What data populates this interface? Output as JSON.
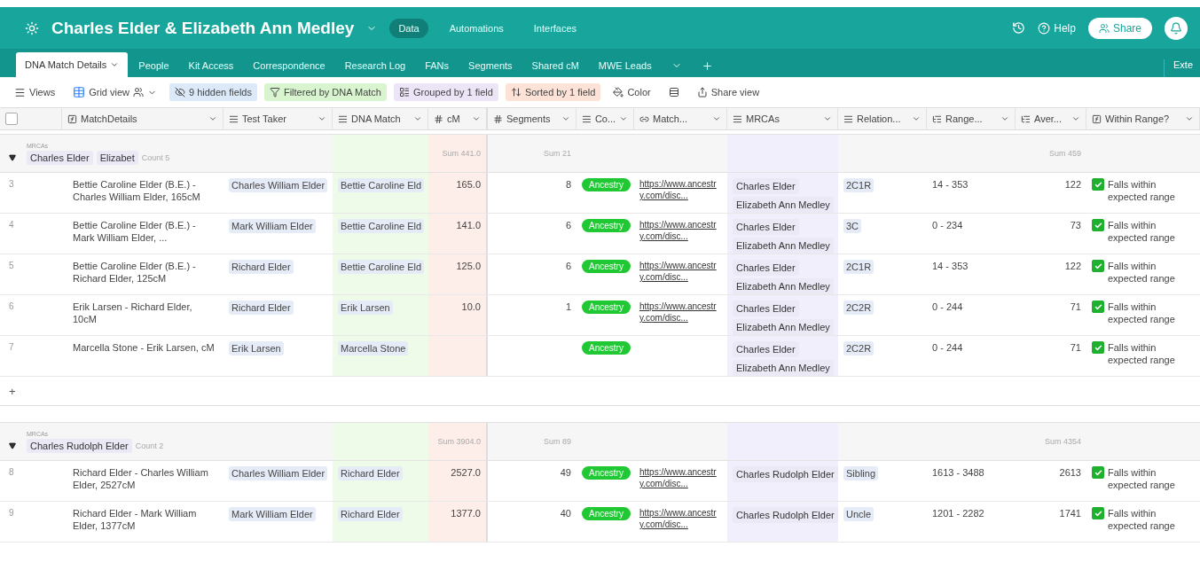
{
  "top_bar": {
    "title": "Charles Elder & Elizabeth Ann Medley",
    "nav": [
      {
        "label": "Data",
        "selected": true
      },
      {
        "label": "Automations",
        "selected": false
      },
      {
        "label": "Interfaces",
        "selected": false
      }
    ],
    "help": "Help",
    "share": "Share"
  },
  "table_tabs": [
    {
      "label": "DNA Match Details",
      "selected": true
    },
    {
      "label": "People",
      "selected": false
    },
    {
      "label": "Kit Access",
      "selected": false
    },
    {
      "label": "Correspondence",
      "selected": false
    },
    {
      "label": "Research Log",
      "selected": false
    },
    {
      "label": "FANs",
      "selected": false
    },
    {
      "label": "Segments",
      "selected": false
    },
    {
      "label": "Shared cM",
      "selected": false
    },
    {
      "label": "MWE Leads",
      "selected": false
    }
  ],
  "extensions_label": "Exte",
  "toolbar": {
    "views": "Views",
    "view_name": "Grid view",
    "buttons": [
      {
        "kind": "hide",
        "label": "9 hidden fields"
      },
      {
        "kind": "filter",
        "label": "Filtered by DNA Match"
      },
      {
        "kind": "group",
        "label": "Grouped by 1 field"
      },
      {
        "kind": "sort",
        "label": "Sorted by 1 field"
      },
      {
        "kind": "color",
        "label": "Color"
      },
      {
        "kind": "height"
      },
      {
        "kind": "share",
        "label": "Share view"
      }
    ]
  },
  "select_all": {
    "checked": false
  },
  "columns": [
    {
      "label": "MatchDetails",
      "kind": "formula"
    },
    {
      "label": "Test Taker",
      "kind": "link"
    },
    {
      "label": "DNA Match",
      "kind": "link",
      "color": "#eefbe9"
    },
    {
      "label": "cM",
      "kind": "number",
      "color": "#fdeeea"
    },
    {
      "label": "Segments",
      "kind": "number"
    },
    {
      "label": "Co...",
      "kind": "select"
    },
    {
      "label": "Match...",
      "kind": "url"
    },
    {
      "label": "MRCAs",
      "kind": "link",
      "color": "#f1effb"
    },
    {
      "label": "Relation...",
      "kind": "link"
    },
    {
      "label": "Range...",
      "kind": "lookup"
    },
    {
      "label": "Aver...",
      "kind": "lookup"
    },
    {
      "label": "Within Range?",
      "kind": "formula"
    }
  ],
  "groups": [
    {
      "field_label": "MRCAs",
      "values": [
        "Charles Elder",
        "Elizabet"
      ],
      "count": "Count 5",
      "sums": {
        "cm": "Sum 441.0",
        "segments": "Sum 21",
        "average": "Sum 459"
      },
      "rows": [
        {
          "number": "3",
          "match_details": "Bettie Caroline Elder (B.E.) - Charles William Elder, 165cM",
          "test_taker": "Charles William Elder",
          "dna_match": "Bettie Caroline Eld",
          "cm": "165.0",
          "segments": "8",
          "company": "Ancestry",
          "match_url": "https://www.ancestry.com/disc...",
          "mrcas": [
            "Charles Elder",
            "Elizabeth Ann Medley"
          ],
          "relationship": "2C1R",
          "range": "14 - 353",
          "average": "122",
          "within_range": {
            "checked": true,
            "text": "Falls within expected range"
          }
        },
        {
          "number": "4",
          "match_details": "Bettie Caroline Elder (B.E.) - Mark William Elder, ...",
          "test_taker": "Mark William Elder",
          "dna_match": "Bettie Caroline Eld",
          "cm": "141.0",
          "segments": "6",
          "company": "Ancestry",
          "match_url": "https://www.ancestry.com/disc...",
          "mrcas": [
            "Charles Elder",
            "Elizabeth Ann Medley"
          ],
          "relationship": "3C",
          "range": "0 - 234",
          "average": "73",
          "within_range": {
            "checked": true,
            "text": "Falls within expected range"
          }
        },
        {
          "number": "5",
          "match_details": "Bettie Caroline Elder (B.E.) - Richard Elder, 125cM",
          "test_taker": "Richard Elder",
          "dna_match": "Bettie Caroline Eld",
          "cm": "125.0",
          "segments": "6",
          "company": "Ancestry",
          "match_url": "https://www.ancestry.com/disc...",
          "mrcas": [
            "Charles Elder",
            "Elizabeth Ann Medley"
          ],
          "relationship": "2C1R",
          "range": "14 - 353",
          "average": "122",
          "within_range": {
            "checked": true,
            "text": "Falls within expected range"
          }
        },
        {
          "number": "6",
          "match_details": "Erik Larsen - Richard Elder, 10cM",
          "test_taker": "Richard Elder",
          "dna_match": "Erik Larsen",
          "cm": "10.0",
          "segments": "1",
          "company": "Ancestry",
          "match_url": "https://www.ancestry.com/disc...",
          "mrcas": [
            "Charles Elder",
            "Elizabeth Ann Medley"
          ],
          "relationship": "2C2R",
          "range": "0 - 244",
          "average": "71",
          "within_range": {
            "checked": true,
            "text": "Falls within expected range"
          }
        },
        {
          "number": "7",
          "match_details": "Marcella Stone - Erik Larsen, cM",
          "test_taker": "Erik Larsen",
          "dna_match": "Marcella Stone",
          "company": "Ancestry",
          "mrcas": [
            "Charles Elder",
            "Elizabeth Ann Medley"
          ],
          "relationship": "2C2R",
          "range": "0 - 244",
          "average": "71",
          "within_range": {
            "checked": true,
            "text": "Falls within expected range"
          }
        }
      ],
      "add_row": "+"
    },
    {
      "field_label": "MRCAs",
      "values": [
        "Charles Rudolph Elder"
      ],
      "count": "Count 2",
      "sums": {
        "cm": "Sum 3904.0",
        "segments": "Sum 89",
        "average": "Sum 4354"
      },
      "rows": [
        {
          "number": "8",
          "match_details": "Richard Elder - Charles William Elder, 2527cM",
          "test_taker": "Charles William Elder",
          "dna_match": "Richard Elder",
          "cm": "2527.0",
          "segments": "49",
          "company": "Ancestry",
          "match_url": "https://www.ancestry.com/disc...",
          "mrcas": [
            "Charles Rudolph Elder"
          ],
          "relationship": "Sibling",
          "range": "1613 - 3488",
          "average": "2613",
          "within_range": {
            "checked": true,
            "text": "Falls within expected range"
          }
        },
        {
          "number": "9",
          "match_details": "Richard Elder - Mark William Elder, 1377cM",
          "test_taker": "Mark William Elder",
          "dna_match": "Richard Elder",
          "cm": "1377.0",
          "segments": "40",
          "company": "Ancestry",
          "match_url": "https://www.ancestry.com/disc...",
          "mrcas": [
            "Charles Rudolph Elder"
          ],
          "relationship": "Uncle",
          "range": "1201 - 2282",
          "average": "1741",
          "within_range": {
            "checked": true,
            "text": "Falls within expected range"
          }
        }
      ]
    }
  ]
}
